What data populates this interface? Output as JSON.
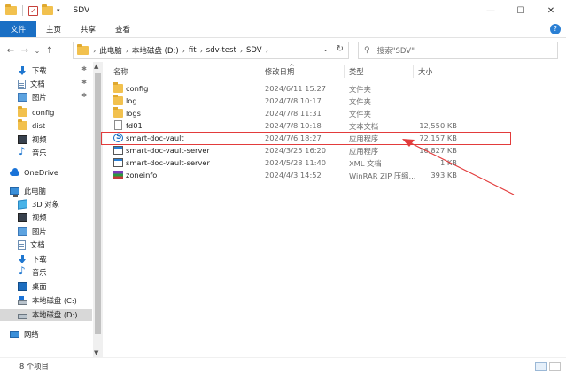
{
  "window": {
    "title": "SDV",
    "minimize": "—",
    "maximize": "☐",
    "close": "✕"
  },
  "ribbon": {
    "tabs": [
      "文件",
      "主页",
      "共享",
      "查看"
    ],
    "help": "?"
  },
  "address": {
    "back": "←",
    "forward": "→",
    "recent": "⌄",
    "up": "↑",
    "crumbs": [
      "此电脑",
      "本地磁盘 (D:)",
      "fit",
      "sdv-test",
      "SDV"
    ],
    "dropdown": "⌄",
    "refresh": "↻",
    "search_placeholder": "搜索\"SDV\""
  },
  "nav": {
    "items": [
      {
        "label": "下载",
        "icon": "download-icon",
        "pinned": true
      },
      {
        "label": "文档",
        "icon": "document-icon",
        "pinned": true
      },
      {
        "label": "图片",
        "icon": "picture-icon",
        "pinned": true
      },
      {
        "label": "config",
        "icon": "folder-icon",
        "pinned": false
      },
      {
        "label": "dist",
        "icon": "folder-icon",
        "pinned": false
      },
      {
        "label": "视频",
        "icon": "video-icon",
        "pinned": false
      },
      {
        "label": "音乐",
        "icon": "music-icon",
        "pinned": false
      },
      {
        "label": "OneDrive",
        "icon": "onedrive-icon",
        "pinned": false
      },
      {
        "label": "此电脑",
        "icon": "this-pc-icon",
        "pinned": false
      },
      {
        "label": "3D 对象",
        "icon": "3d-objects-icon",
        "pinned": false
      },
      {
        "label": "视频",
        "icon": "video-icon",
        "pinned": false
      },
      {
        "label": "图片",
        "icon": "picture-icon",
        "pinned": false
      },
      {
        "label": "文档",
        "icon": "document-icon",
        "pinned": false
      },
      {
        "label": "下载",
        "icon": "download-icon",
        "pinned": false
      },
      {
        "label": "音乐",
        "icon": "music-icon",
        "pinned": false
      },
      {
        "label": "桌面",
        "icon": "desktop-icon",
        "pinned": false
      },
      {
        "label": "本地磁盘 (C:)",
        "icon": "system-drive-icon",
        "pinned": false
      },
      {
        "label": "本地磁盘 (D:)",
        "icon": "drive-icon",
        "pinned": false,
        "selected": true
      },
      {
        "label": "网络",
        "icon": "network-icon",
        "pinned": false
      }
    ]
  },
  "columns": {
    "name": "名称",
    "date": "修改日期",
    "type": "类型",
    "size": "大小"
  },
  "files": [
    {
      "name": "config",
      "date": "2024/6/11 15:27",
      "type": "文件夹",
      "size": "",
      "icon": "folder-icon"
    },
    {
      "name": "log",
      "date": "2024/7/8 10:17",
      "type": "文件夹",
      "size": "",
      "icon": "folder-icon"
    },
    {
      "name": "logs",
      "date": "2024/7/8 11:31",
      "type": "文件夹",
      "size": "",
      "icon": "folder-icon"
    },
    {
      "name": "fd01",
      "date": "2024/7/8 10:18",
      "type": "文本文档",
      "size": "12,550 KB",
      "icon": "text-file-icon"
    },
    {
      "name": "smart-doc-vault",
      "date": "2024/7/6 18:27",
      "type": "应用程序",
      "size": "72,157 KB",
      "icon": "application-icon"
    },
    {
      "name": "smart-doc-vault-server",
      "date": "2024/3/25 16:20",
      "type": "应用程序",
      "size": "16,827 KB",
      "icon": "exe-icon"
    },
    {
      "name": "smart-doc-vault-server",
      "date": "2024/5/28 11:40",
      "type": "XML 文档",
      "size": "1 KB",
      "icon": "exe-icon"
    },
    {
      "name": "zoneinfo",
      "date": "2024/4/3 14:52",
      "type": "WinRAR ZIP 压缩...",
      "size": "393 KB",
      "icon": "winrar-icon"
    }
  ],
  "status": {
    "count": "8 个项目"
  },
  "colors": {
    "accent": "#1a6fc4",
    "highlight": "#e23b3b",
    "folder": "#f2c14e"
  }
}
